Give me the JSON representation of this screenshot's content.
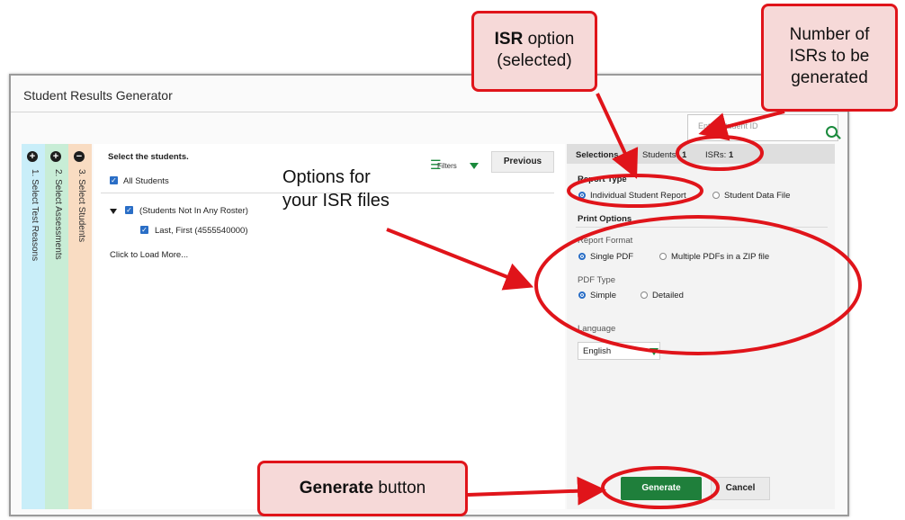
{
  "window": {
    "title": "Student Results Generator"
  },
  "search": {
    "placeholder": "Enter Student ID"
  },
  "steps": [
    {
      "label": "1. Select Test Reasons",
      "icon": "plus-circle-icon"
    },
    {
      "label": "2. Select Assessments",
      "icon": "plus-circle-icon"
    },
    {
      "label": "3. Select Students",
      "icon": "minus-circle-icon"
    }
  ],
  "students": {
    "heading": "Select the students.",
    "filters_label": "Filters",
    "previous_label": "Previous",
    "all_students": "All Students",
    "roster_group": "(Students Not In Any Roster)",
    "student": "Last, First (4555540000)",
    "load_more": "Click to Load More..."
  },
  "selections": {
    "label": "Selections",
    "students_label": "Students:",
    "students_count": "1",
    "isrs_label": "ISRs:",
    "isrs_count": "1"
  },
  "report_type": {
    "heading": "Report Type",
    "options": [
      "Individual Student Report",
      "Student Data File"
    ],
    "selected": "Individual Student Report"
  },
  "print_options": {
    "heading": "Print Options",
    "report_format_label": "Report Format",
    "report_format_options": [
      "Single PDF",
      "Multiple PDFs in a ZIP file"
    ],
    "pdf_type_label": "PDF Type",
    "pdf_type_options": [
      "Simple",
      "Detailed"
    ],
    "language_label": "Language",
    "language_value": "English"
  },
  "actions": {
    "generate": "Generate",
    "cancel": "Cancel"
  },
  "callouts": {
    "isr_bold": "ISR",
    "isr_rest": "option",
    "isr_line2": "(selected)",
    "num_line1": "Number of",
    "num_line2": "ISRs to be",
    "num_line3": "generated",
    "options_line1": "Options for",
    "options_line2": "your ISR files",
    "generate_bold": "Generate",
    "generate_rest": "button"
  },
  "colors": {
    "annotation_red": "#e0141a",
    "callout_fill": "#f6d9d8",
    "accent_green": "#1f7f3b",
    "checkbox_blue": "#2a6ec6",
    "tab1": "#c9eef9",
    "tab2": "#c8edd6",
    "tab3": "#f9dcc2"
  }
}
